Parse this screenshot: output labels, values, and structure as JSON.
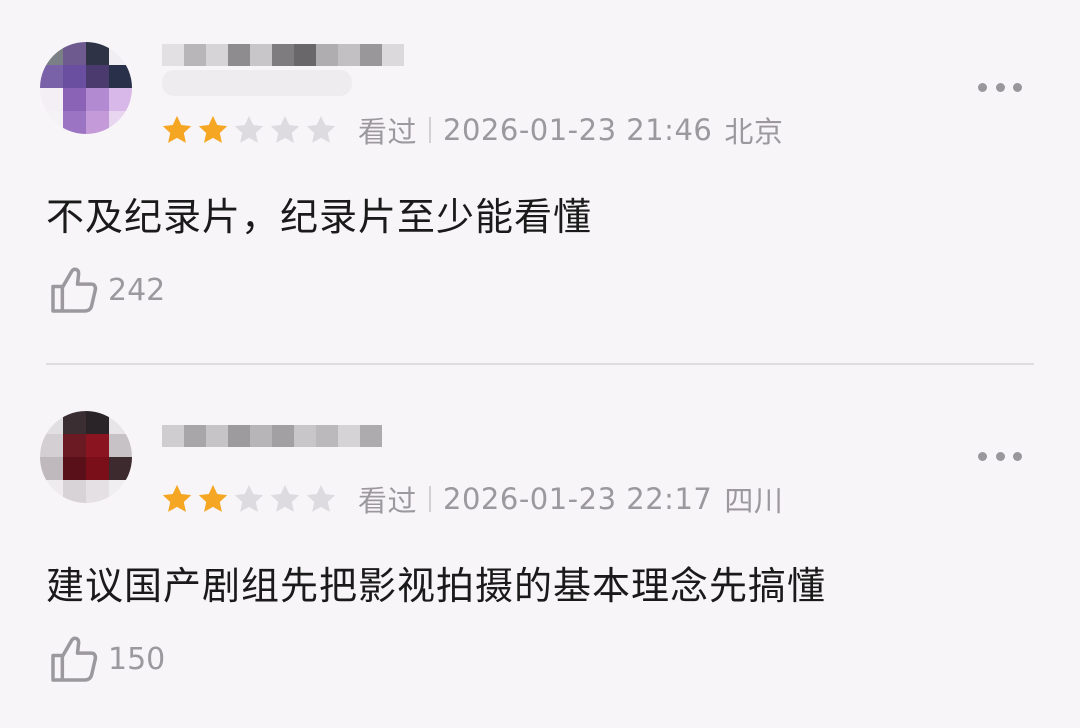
{
  "comments": [
    {
      "rating": 2,
      "rating_max": 5,
      "status": "看过",
      "datetime": "2026-01-23 21:46",
      "location": "北京",
      "text": "不及纪录片，纪录片至少能看懂",
      "likes": "242",
      "avatar_icon": "pixelated-avatar",
      "username_icon": "blurred-username"
    },
    {
      "rating": 2,
      "rating_max": 5,
      "status": "看过",
      "datetime": "2026-01-23 22:17",
      "location": "四川",
      "text": "建议国产剧组先把影视拍摄的基本理念先搞懂",
      "likes": "150",
      "avatar_icon": "pixelated-avatar",
      "username_icon": "blurred-username"
    }
  ],
  "colors": {
    "background": "#f8f5f8",
    "star_filled": "#f5a623",
    "star_empty": "#dedbe0",
    "meta_text": "#9c999e",
    "body_text": "#1a1a1a"
  },
  "icons": {
    "more": "more-horizontal-icon",
    "like": "thumbs-up-icon",
    "star": "star-icon"
  }
}
